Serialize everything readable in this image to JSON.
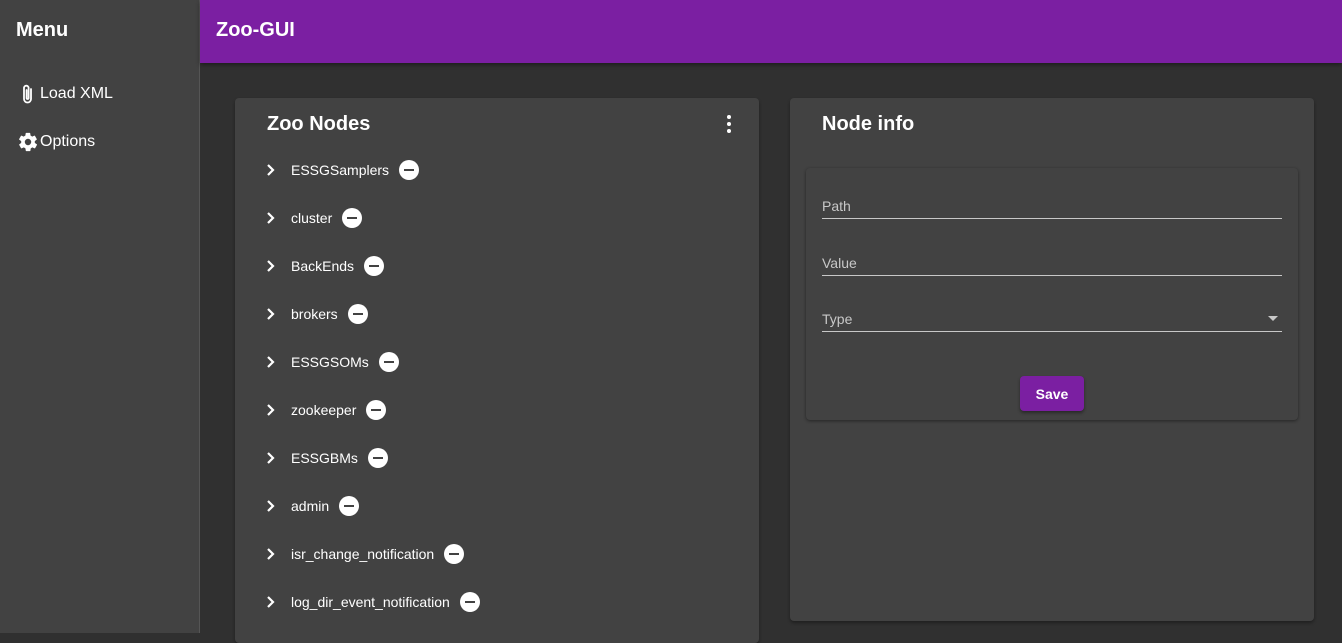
{
  "sidebar": {
    "title": "Menu",
    "items": [
      {
        "label": "Load XML",
        "icon": "paperclip-icon"
      },
      {
        "label": "Options",
        "icon": "gear-icon"
      }
    ]
  },
  "header": {
    "title": "Zoo-GUI",
    "color": "#7b1fa2"
  },
  "zoo_nodes": {
    "title": "Zoo Nodes",
    "nodes": [
      "ESSGSamplers",
      "cluster",
      "BackEnds",
      "brokers",
      "ESSGSOMs",
      "zookeeper",
      "ESSGBMs",
      "admin",
      "isr_change_notification",
      "log_dir_event_notification"
    ]
  },
  "node_info": {
    "title": "Node info",
    "path_placeholder": "Path",
    "value_placeholder": "Value",
    "type_placeholder": "Type",
    "save_label": "Save"
  }
}
